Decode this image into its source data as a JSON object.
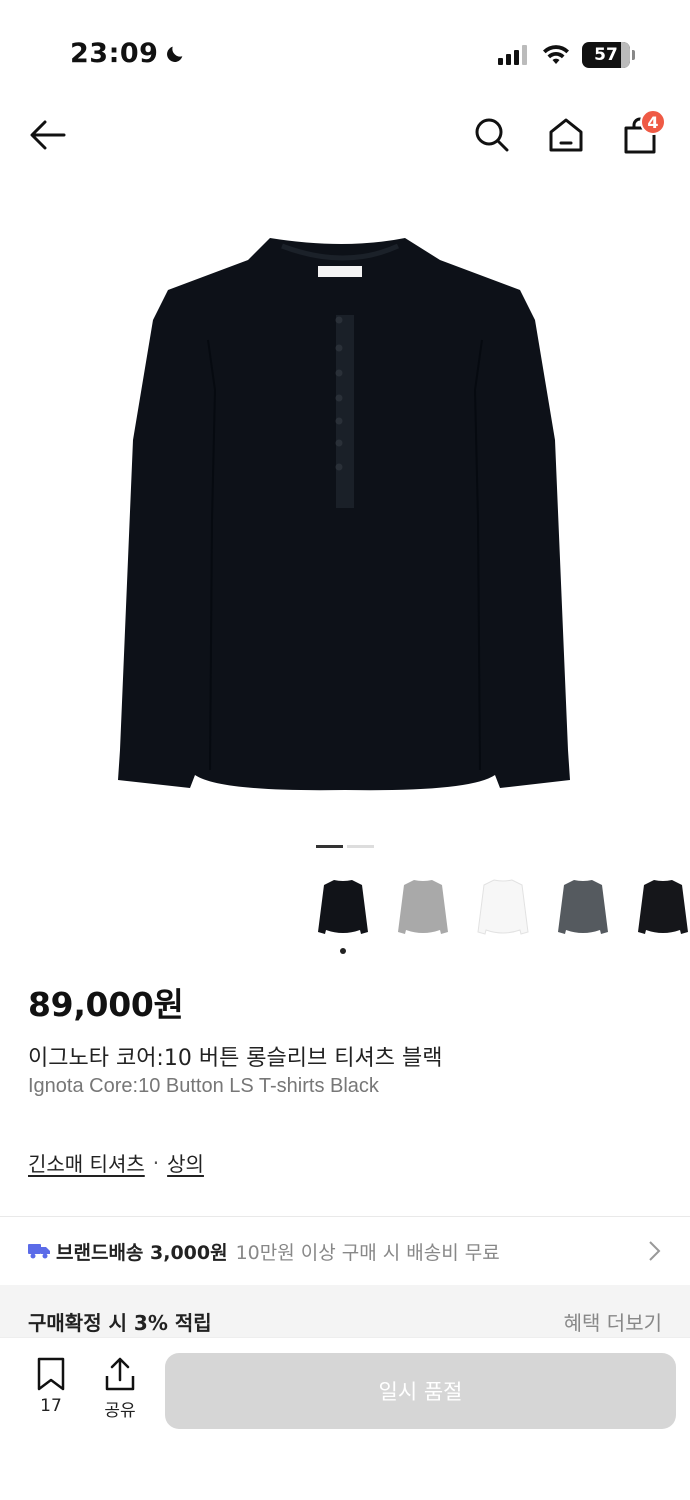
{
  "status_bar": {
    "time": "23:09",
    "battery": "57",
    "icons": [
      "moon-icon",
      "signal-icon",
      "wifi-icon",
      "battery-icon"
    ]
  },
  "nav": {
    "icons": [
      "back-arrow-icon",
      "search-icon",
      "home-icon",
      "cart-icon"
    ],
    "cart_count": "4"
  },
  "product": {
    "price": "89,000원",
    "title_ko": "이그노타 코어:10 버튼 롱슬리브 티셔츠 블랙",
    "title_en": "Ignota Core:10 Button LS T-shirts Black",
    "categories": [
      "긴소매 티셔츠",
      "상의"
    ],
    "category_separator": "·",
    "image_count": 2,
    "image_index": 1,
    "variants": [
      {
        "color": "#111318",
        "selected": true
      },
      {
        "color": "#a9a9a9",
        "selected": false
      },
      {
        "color": "#f7f7f7",
        "selected": false
      },
      {
        "color": "#555a5f",
        "selected": false
      },
      {
        "color": "#15161a",
        "selected": false
      }
    ]
  },
  "shipping": {
    "label": "브랜드배송 3,000원",
    "note": "10만원 이상 구매 시 배송비 무료",
    "icon": "truck-icon",
    "icon_color": "#5b6be8"
  },
  "benefit": {
    "label": "구매확정 시 3% 적립",
    "more": "혜택 더보기"
  },
  "bottom": {
    "bookmark_count": "17",
    "share_label": "공유",
    "cta_label": "일시 품절",
    "cta_color": "#d6d6d6"
  }
}
